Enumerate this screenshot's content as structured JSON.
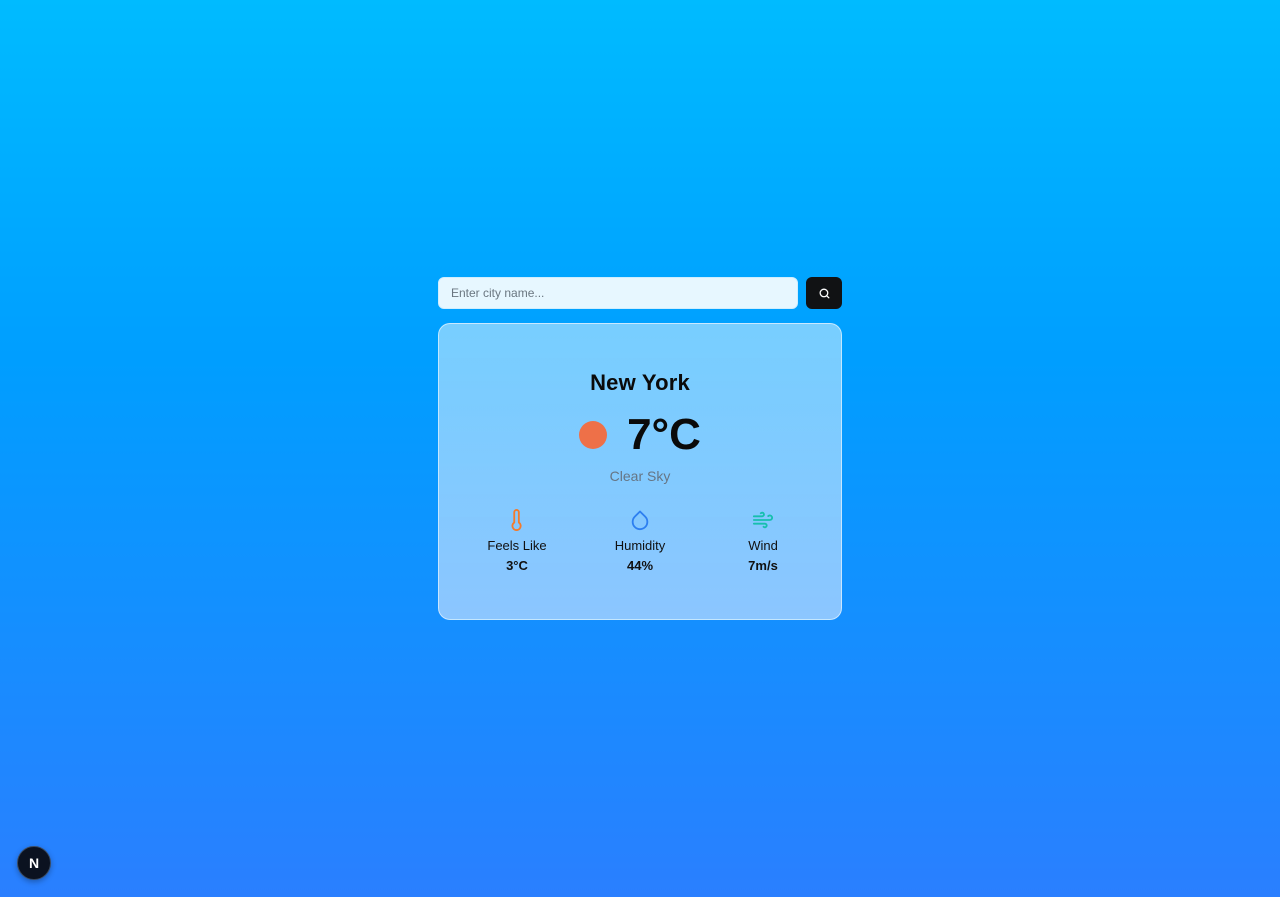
{
  "search": {
    "placeholder": "Enter city name...",
    "value": "",
    "button_icon": "search-icon"
  },
  "weather": {
    "city": "New York",
    "temperature": "7°C",
    "condition": "Clear Sky",
    "condition_icon": "sun-icon",
    "stats": [
      {
        "label": "Feels Like",
        "value": "3°C",
        "icon": "thermometer-icon",
        "color": "#f47a2a"
      },
      {
        "label": "Humidity",
        "value": "44%",
        "icon": "droplet-icon",
        "color": "#2d7ff0"
      },
      {
        "label": "Wind",
        "value": "7m/s",
        "icon": "wind-icon",
        "color": "#17bfae"
      }
    ]
  },
  "dev_badge": {
    "label": "N"
  },
  "colors": {
    "sun": "#ee7048",
    "button_bg": "#111214",
    "bg_top": "#00bbff",
    "bg_bottom": "#2a7fff"
  }
}
